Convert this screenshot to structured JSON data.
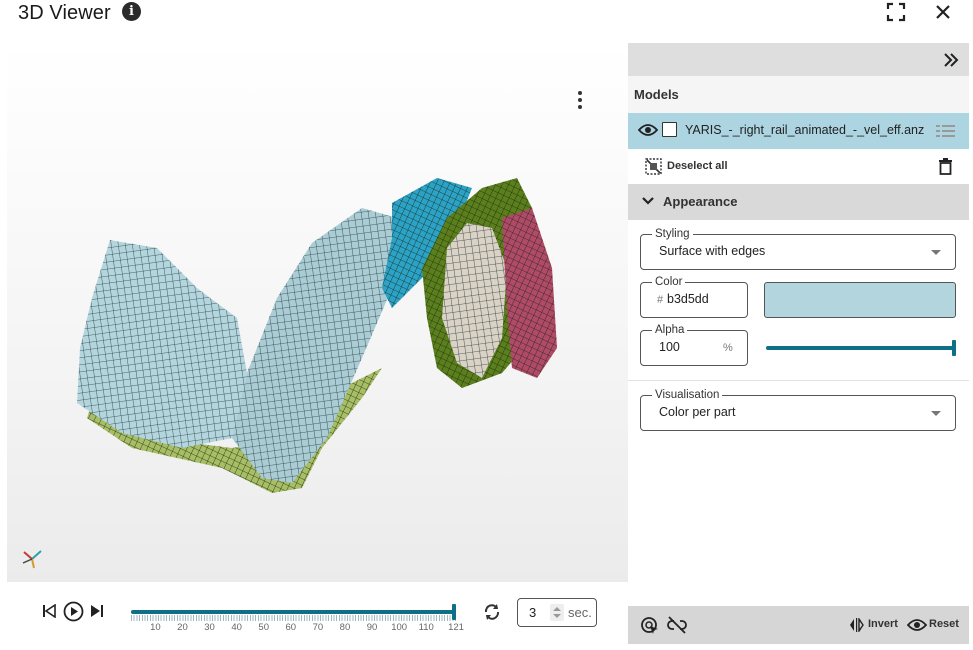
{
  "header": {
    "title": "3D Viewer",
    "info_icon": "info-icon",
    "fullscreen_icon": "fullscreen-icon",
    "close_icon": "close-icon"
  },
  "viewport": {
    "menu_icon": "kebab-menu-icon",
    "axis_icon": "axis-triad-icon",
    "model_colors": [
      "#b3d5dd",
      "#a7be65",
      "#2ba3c8",
      "#5b7f1c",
      "#d9d2c5",
      "#b04a68"
    ]
  },
  "playback": {
    "tick_labels": [
      "10",
      "20",
      "30",
      "40",
      "50",
      "60",
      "70",
      "80",
      "90",
      "100",
      "110",
      "121"
    ],
    "slider_position": 1.0,
    "duration_value": "3",
    "duration_unit": "sec."
  },
  "panel": {
    "models_label": "Models",
    "model": {
      "name": "YARIS_-_right_rail_animated_-_vel_eff.anz",
      "visible": true,
      "checked": false
    },
    "deselect_label": "Deselect all",
    "appearance_label": "Appearance",
    "styling": {
      "label": "Styling",
      "value": "Surface with edges"
    },
    "color": {
      "label": "Color",
      "hash": "#",
      "value": "b3d5dd",
      "swatch": "#b3d5dd"
    },
    "alpha": {
      "label": "Alpha",
      "value": "100",
      "unit": "%",
      "fraction": 1.0
    },
    "visualisation": {
      "label": "Visualisation",
      "value": "Color per part"
    },
    "footer": {
      "invert_label": "Invert",
      "reset_label": "Reset"
    }
  },
  "colors": {
    "accent": "#0f6f86",
    "selected_row": "#acd4e1",
    "panel_header": "#dedede"
  }
}
